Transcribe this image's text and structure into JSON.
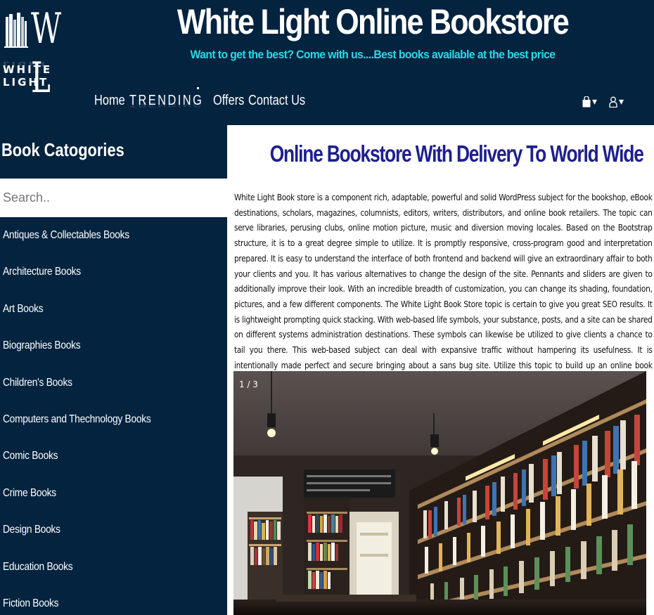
{
  "header": {
    "logo_initials": "W L",
    "logo_text": "WHITE LIGHT",
    "title": "White Light Online Bookstore",
    "tagline": "Want to get the best? Come with us....Best books available at the best price"
  },
  "nav": {
    "home": "Home",
    "trending": "TRENDING",
    "offers": "Offers",
    "contact": "Contact Us"
  },
  "icons": {
    "cart": "shopping-bag-icon",
    "user": "user-icon",
    "caret": "▾"
  },
  "sidebar": {
    "title": "Book Catogories",
    "search_placeholder": "Search..",
    "categories": [
      "Antiques & Collectables Books",
      "Architecture Books",
      "Art Books",
      "Biographies Books",
      "Children's Books",
      "Computers and Thechnology Books",
      "Comic Books",
      "Crime Books",
      "Design Books",
      "Education Books",
      "Fiction Books"
    ]
  },
  "main": {
    "heading": "Online Bookstore With Delivery To World Wide",
    "paragraph": "White Light Book store is a component rich, adaptable, powerful and solid WordPress subject for the bookshop, eBook destinations, scholars, magazines, columnists, editors, writers, distributors, and online book retailers. The topic can serve libraries, perusing clubs, online motion picture, music and diversion moving locales. Based on the Bootstrap structure, it is to a great degree simple to utilize. It is promptly responsive, cross-program good and interpretation prepared. It is easy to understand the interface of both frontend and backend will give an extraordinary affair to both your clients and you. It has various alternatives to change the design of the site. Pennants and sliders are given to additionally improve their look. With an incredible breadth of customization, you can change its shading, foundation, pictures, and a few different components. The White Light Book Store topic is certain to give you great SEO results. It is lightweight prompting quick stacking. With web-based life symbols, your substance, posts, and a site can be shared on different systems administration destinations. These symbols can likewise be utilized to give clients a chance to tail you there. This web-based subject can deal with expansive traffic without hampering its usefulness. It is intentionally made perfect and secure bringing about a sans bug site. Utilize this topic to build up an online book centre point for perusing and writing darlings.",
    "slider_counter": "1 / 3"
  },
  "colors": {
    "navy": "#03233f",
    "tagline": "#2ad9e6",
    "heading": "#1f1f8e"
  }
}
